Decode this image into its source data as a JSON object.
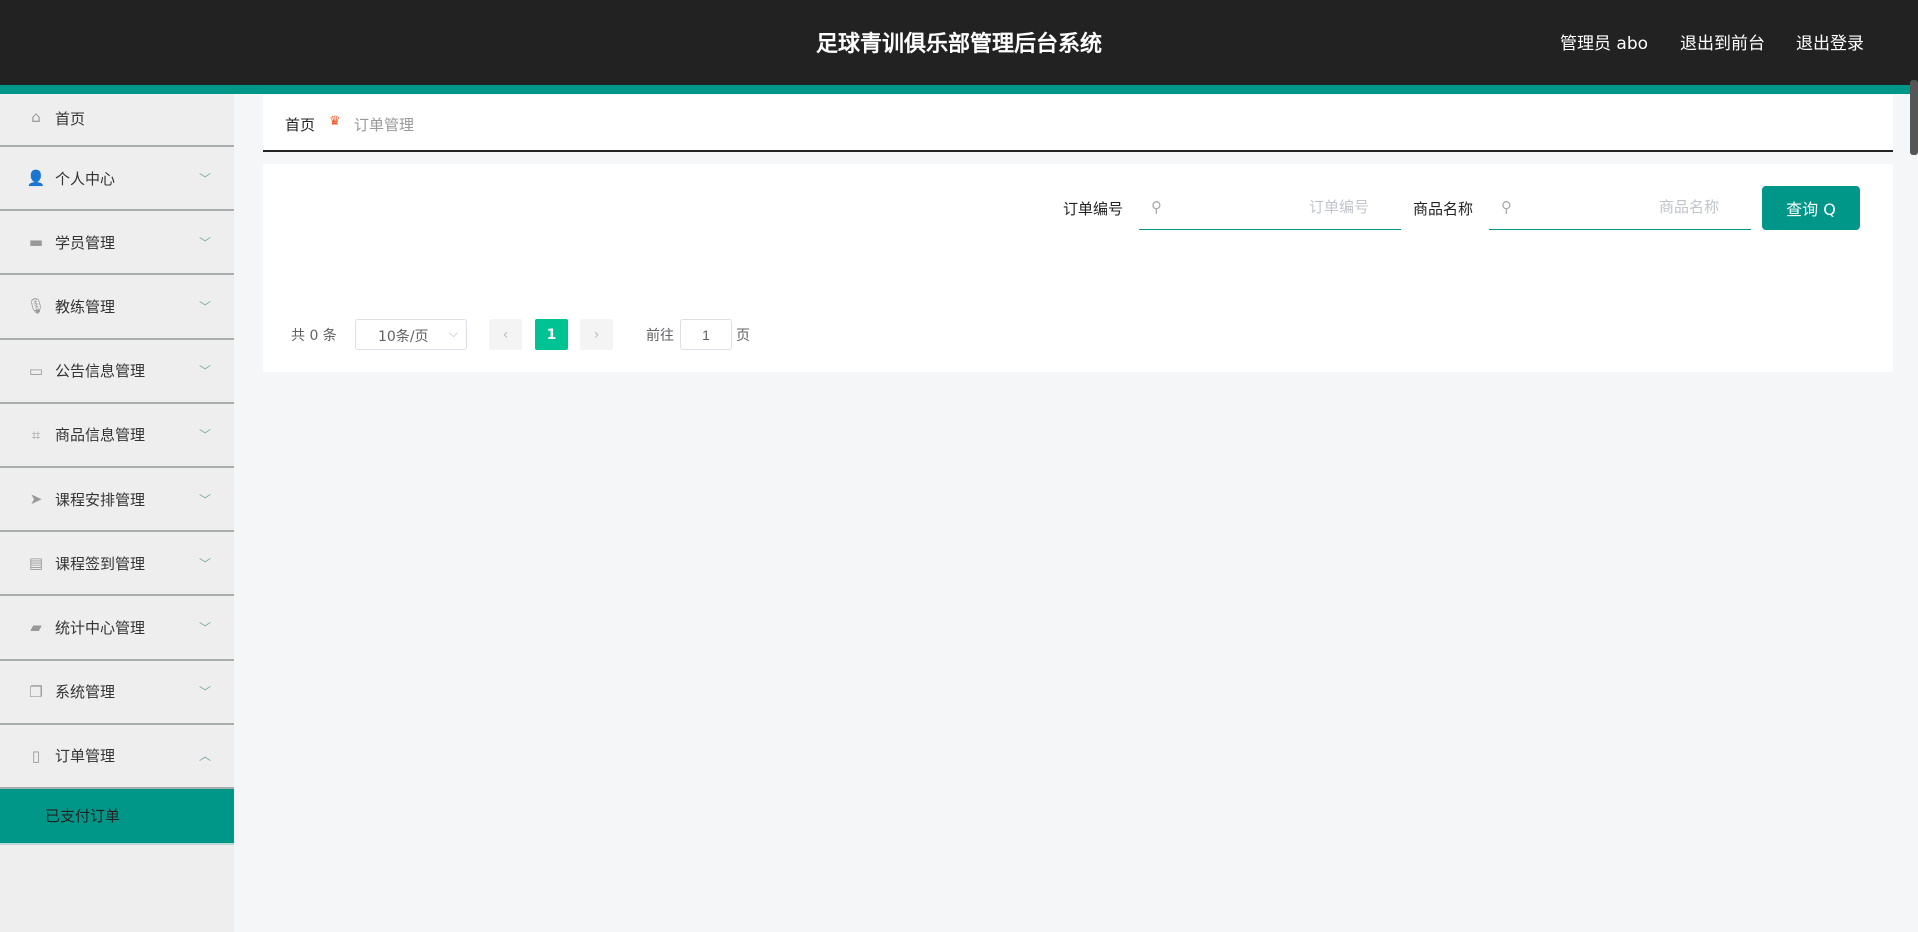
{
  "header": {
    "title": "足球青训俱乐部管理后台系统",
    "user": "管理员 abo",
    "front": "退出到前台",
    "logout": "退出登录"
  },
  "sidebar": {
    "items": [
      {
        "label": "首页",
        "icon": "home-icon",
        "glyph": "⌂"
      },
      {
        "label": "个人中心",
        "icon": "user-icon",
        "glyph": "👤"
      },
      {
        "label": "学员管理",
        "icon": "briefcase-icon",
        "glyph": "▬"
      },
      {
        "label": "教练管理",
        "icon": "microphone-icon",
        "glyph": "🎙"
      },
      {
        "label": "公告信息管理",
        "icon": "message-icon",
        "glyph": "▭"
      },
      {
        "label": "商品信息管理",
        "icon": "crop-icon",
        "glyph": "⌗"
      },
      {
        "label": "课程安排管理",
        "icon": "send-icon",
        "glyph": "➤"
      },
      {
        "label": "课程签到管理",
        "icon": "clipboard-icon",
        "glyph": "▤"
      },
      {
        "label": "统计中心管理",
        "icon": "ticket-icon",
        "glyph": "▰"
      },
      {
        "label": "系统管理",
        "icon": "copy-icon",
        "glyph": "❐"
      },
      {
        "label": "订单管理",
        "icon": "phone-icon",
        "glyph": "▯"
      }
    ],
    "sub": "已支付订单"
  },
  "breadcrumb": {
    "home": "首页",
    "current": "订单管理"
  },
  "search": {
    "order_label": "订单编号",
    "order_placeholder": "订单编号",
    "product_label": "商品名称",
    "product_placeholder": "商品名称",
    "button": "查询 Q"
  },
  "pagination": {
    "total": "共 0 条",
    "page_size": "10条/页",
    "current_page": "1",
    "goto": "前往",
    "goto_value": "1",
    "page_unit": "页"
  },
  "colors": {
    "accent": "#009688",
    "page_active": "#00c292",
    "header": "#222222"
  }
}
